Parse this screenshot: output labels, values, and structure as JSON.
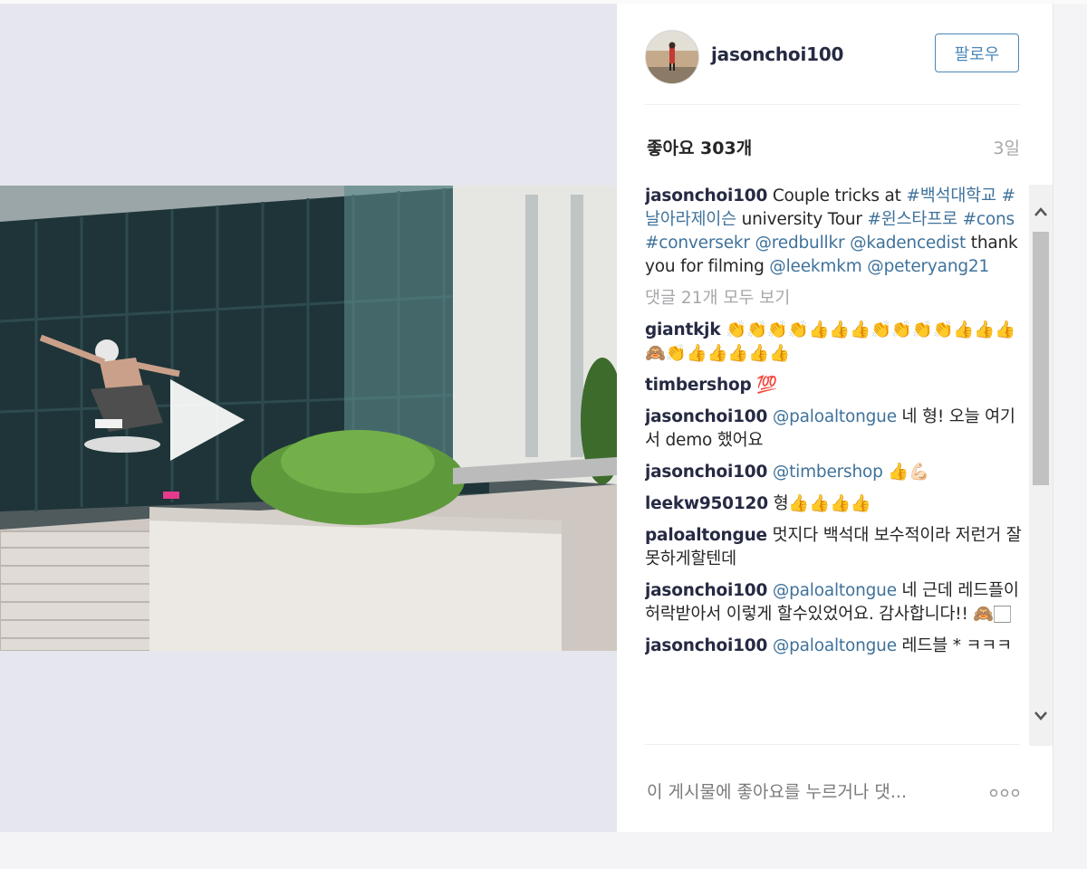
{
  "post": {
    "username": "jasonchoi100",
    "follow_label": "팔로우",
    "likes": "좋아요 303개",
    "time_ago": "3일"
  },
  "caption": {
    "username": "jasonchoi100",
    "parts": [
      {
        "text": "Couple tricks at ",
        "type": "text"
      },
      {
        "text": "#백석대학교",
        "type": "tag"
      },
      {
        "text": " ",
        "type": "text"
      },
      {
        "text": "#날아라제이슨",
        "type": "tag"
      },
      {
        "text": " university Tour ",
        "type": "text"
      },
      {
        "text": "#윈스타프로",
        "type": "tag"
      },
      {
        "text": " ",
        "type": "text"
      },
      {
        "text": "#cons",
        "type": "tag"
      },
      {
        "text": " ",
        "type": "text"
      },
      {
        "text": "#conversekr",
        "type": "tag"
      },
      {
        "text": " ",
        "type": "text"
      },
      {
        "text": "@redbullkr",
        "type": "tag"
      },
      {
        "text": " ",
        "type": "text"
      },
      {
        "text": "@kadencedist",
        "type": "tag"
      },
      {
        "text": " thank you for filming ",
        "type": "text"
      },
      {
        "text": "@leekmkm",
        "type": "tag"
      },
      {
        "text": " ",
        "type": "text"
      },
      {
        "text": "@peteryang21",
        "type": "tag"
      }
    ]
  },
  "view_all_comments": "댓글 21개 모두 보기",
  "comments": [
    {
      "username": "giantkjk",
      "mention": "",
      "text": " 👏👏👏👏👍👍👍👏👏👏👏👍👍👍🙈👏👍👍👍👍👍"
    },
    {
      "username": "timbershop",
      "mention": "",
      "text": " 💯"
    },
    {
      "username": "jasonchoi100",
      "mention": "@paloaltongue",
      "text": " 네 형! 오늘 여기서 demo 했어요"
    },
    {
      "username": "jasonchoi100",
      "mention": "@timbershop",
      "text": " 👍💪🏻"
    },
    {
      "username": "leekw950120",
      "mention": "",
      "text": " 형👍👍👍👍"
    },
    {
      "username": "paloaltongue",
      "mention": "",
      "text": " 멋지다 백석대 보수적이라 저런거 잘 못하게할텐데"
    },
    {
      "username": "jasonchoi100",
      "mention": "@paloaltongue",
      "text": " 네 근데 레드플이 허락받아서 이렇게 할수있었어요. 감사합니다!! 🙈🏻"
    },
    {
      "username": "jasonchoi100",
      "mention": "@paloaltongue",
      "text": " 레드블 * ㅋㅋㅋ"
    }
  ],
  "comment_input": {
    "placeholder": "이 게시물에 좋아요를 누르거나 댓..."
  },
  "icons": {
    "play": "play-icon",
    "more": "more-options-icon",
    "scroll_up": "chevron-up-icon",
    "scroll_down": "chevron-down-icon"
  },
  "colors": {
    "link": "#3f729b",
    "username": "#262a43",
    "follow_border": "#4b87b8",
    "muted": "#a5a7aa"
  }
}
